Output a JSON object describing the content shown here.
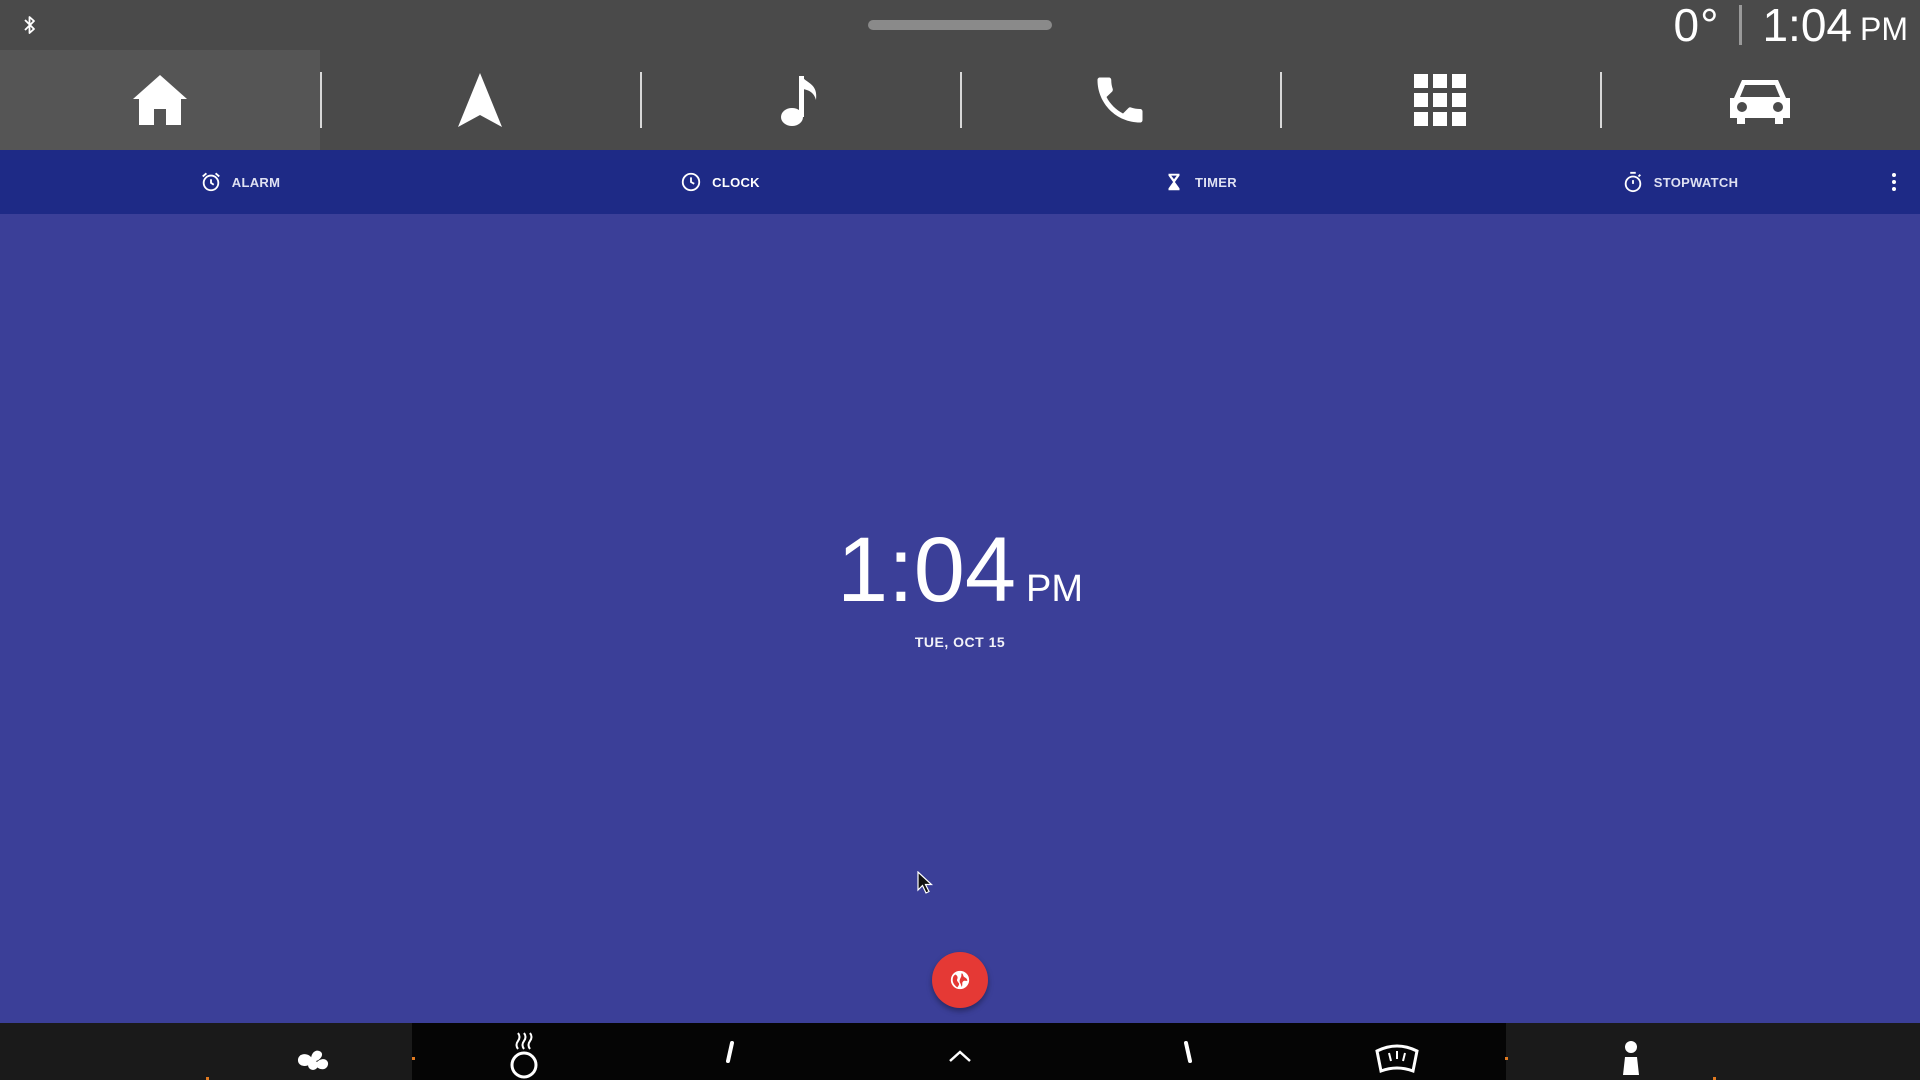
{
  "status": {
    "bluetooth_icon": "bluetooth-icon",
    "temperature": "0°",
    "time": "1:04",
    "ampm": "PM"
  },
  "app_bar": {
    "items": [
      {
        "name": "home",
        "icon": "home-icon",
        "active": true
      },
      {
        "name": "navigation",
        "icon": "navigation-arrow-icon"
      },
      {
        "name": "music",
        "icon": "music-note-icon"
      },
      {
        "name": "phone",
        "icon": "phone-icon"
      },
      {
        "name": "apps",
        "icon": "apps-grid-icon"
      },
      {
        "name": "car",
        "icon": "car-icon"
      }
    ]
  },
  "tabs": [
    {
      "label": "ALARM",
      "icon": "alarm-icon"
    },
    {
      "label": "CLOCK",
      "icon": "clock-icon",
      "selected": true
    },
    {
      "label": "TIMER",
      "icon": "hourglass-icon"
    },
    {
      "label": "STOPWATCH",
      "icon": "stopwatch-icon"
    }
  ],
  "clock": {
    "time": "1:04",
    "ampm": "PM",
    "date": "TUE, OCT 15"
  },
  "fab": {
    "icon": "globe-icon"
  },
  "climate_bar": {
    "items": [
      "fan-icon",
      "seat-heat-icon",
      "seat-icon",
      "chevron-up-icon",
      "seat-icon",
      "defrost-icon",
      "person-icon"
    ]
  },
  "colors": {
    "background": "#3b3f98",
    "tab_bar": "#1e2a86",
    "top_bar": "#4a4a4a",
    "fab": "#e53935",
    "accent_dot": "#e07a20"
  }
}
